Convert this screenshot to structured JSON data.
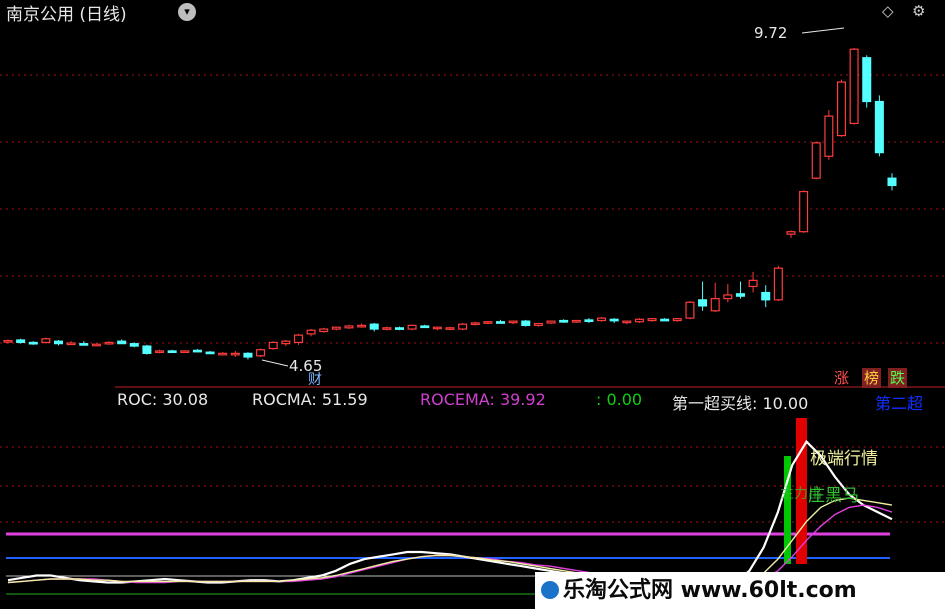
{
  "header": {
    "title": "南京公用 (日线)",
    "dropdown_glyph": "▾",
    "diamond_glyph": "◇",
    "gear_glyph": "⚙"
  },
  "indicator": {
    "roc_label": "ROC: 30.08",
    "rocma_label": "ROCMA: 51.59",
    "rocema_label": "ROCEMA: 39.92",
    "zero_label": ": 0.00",
    "buyline_label": "第一超买线: 10.00",
    "second_label": "第二超"
  },
  "badges": {
    "zhang": "涨",
    "bang": "榜",
    "die": "跌"
  },
  "watermark": "乐淘公式网 www.60lt.com",
  "colors": {
    "up": "#ff3c3c",
    "down": "#54ffff",
    "text": "#e8e8e8",
    "magenta": "#e040e0",
    "green": "#00d000",
    "blue": "#2060ff",
    "yellow": "#f0f0a0",
    "grid": "#a01010"
  },
  "chart_data": [
    {
      "type": "candlestick",
      "series_note": "",
      "max_label": "9.72",
      "min_label": "4.65",
      "cai_label": "财",
      "ylim": [
        4.2,
        10.2
      ],
      "ohlc": [
        [
          4.92,
          4.95,
          4.88,
          4.93
        ],
        [
          4.94,
          4.96,
          4.88,
          4.9
        ],
        [
          4.9,
          4.92,
          4.86,
          4.88
        ],
        [
          4.9,
          4.98,
          4.88,
          4.96
        ],
        [
          4.92,
          4.94,
          4.85,
          4.88
        ],
        [
          4.88,
          4.92,
          4.86,
          4.89
        ],
        [
          4.88,
          4.92,
          4.85,
          4.86
        ],
        [
          4.86,
          4.88,
          4.85,
          4.87
        ],
        [
          4.88,
          4.92,
          4.86,
          4.9
        ],
        [
          4.92,
          4.95,
          4.88,
          4.88
        ],
        [
          4.88,
          4.9,
          4.82,
          4.84
        ],
        [
          4.84,
          4.86,
          4.7,
          4.72
        ],
        [
          4.74,
          4.78,
          4.72,
          4.76
        ],
        [
          4.76,
          4.78,
          4.74,
          4.75
        ],
        [
          4.75,
          4.77,
          4.73,
          4.76
        ],
        [
          4.77,
          4.79,
          4.74,
          4.75
        ],
        [
          4.74,
          4.76,
          4.71,
          4.72
        ],
        [
          4.72,
          4.74,
          4.7,
          4.72
        ],
        [
          4.72,
          4.76,
          4.66,
          4.72
        ],
        [
          4.72,
          4.74,
          4.62,
          4.66
        ],
        [
          4.68,
          4.8,
          4.66,
          4.78
        ],
        [
          4.8,
          4.92,
          4.78,
          4.9
        ],
        [
          4.88,
          4.94,
          4.84,
          4.92
        ],
        [
          4.9,
          5.04,
          4.86,
          5.02
        ],
        [
          5.04,
          5.12,
          5.0,
          5.1
        ],
        [
          5.08,
          5.14,
          5.06,
          5.12
        ],
        [
          5.12,
          5.16,
          5.1,
          5.15
        ],
        [
          5.14,
          5.19,
          5.12,
          5.17
        ],
        [
          5.18,
          5.21,
          5.14,
          5.18
        ],
        [
          5.2,
          5.22,
          5.08,
          5.12
        ],
        [
          5.12,
          5.16,
          5.1,
          5.14
        ],
        [
          5.14,
          5.16,
          5.1,
          5.12
        ],
        [
          5.12,
          5.19,
          5.1,
          5.18
        ],
        [
          5.17,
          5.19,
          5.14,
          5.16
        ],
        [
          5.14,
          5.16,
          5.1,
          5.15
        ],
        [
          5.12,
          5.16,
          5.1,
          5.14
        ],
        [
          5.12,
          5.22,
          5.1,
          5.2
        ],
        [
          5.2,
          5.24,
          5.18,
          5.22
        ],
        [
          5.22,
          5.25,
          5.2,
          5.24
        ],
        [
          5.24,
          5.27,
          5.22,
          5.23
        ],
        [
          5.24,
          5.26,
          5.2,
          5.25
        ],
        [
          5.25,
          5.27,
          5.16,
          5.18
        ],
        [
          5.18,
          5.22,
          5.16,
          5.21
        ],
        [
          5.22,
          5.26,
          5.2,
          5.25
        ],
        [
          5.26,
          5.28,
          5.22,
          5.24
        ],
        [
          5.24,
          5.27,
          5.22,
          5.26
        ],
        [
          5.27,
          5.3,
          5.22,
          5.25
        ],
        [
          5.26,
          5.32,
          5.24,
          5.3
        ],
        [
          5.28,
          5.3,
          5.22,
          5.26
        ],
        [
          5.24,
          5.26,
          5.2,
          5.25
        ],
        [
          5.24,
          5.3,
          5.22,
          5.28
        ],
        [
          5.26,
          5.3,
          5.24,
          5.29
        ],
        [
          5.28,
          5.3,
          5.26,
          5.27
        ],
        [
          5.26,
          5.3,
          5.24,
          5.29
        ],
        [
          5.3,
          5.58,
          5.28,
          5.56
        ],
        [
          5.6,
          5.9,
          5.42,
          5.5
        ],
        [
          5.42,
          5.88,
          5.4,
          5.62
        ],
        [
          5.62,
          5.86,
          5.56,
          5.68
        ],
        [
          5.7,
          5.9,
          5.62,
          5.66
        ],
        [
          5.82,
          6.06,
          5.72,
          5.92
        ],
        [
          5.72,
          5.84,
          5.48,
          5.6
        ],
        [
          5.6,
          6.16,
          5.58,
          6.12
        ],
        [
          6.68,
          6.74,
          6.62,
          6.72
        ],
        [
          6.72,
          7.4,
          6.7,
          7.38
        ],
        [
          7.6,
          8.2,
          7.58,
          8.18
        ],
        [
          7.96,
          8.72,
          7.9,
          8.62
        ],
        [
          8.3,
          9.22,
          8.28,
          9.18
        ],
        [
          8.5,
          9.74,
          8.48,
          9.72
        ],
        [
          9.58,
          9.62,
          8.76,
          8.86
        ],
        [
          8.86,
          8.96,
          7.96,
          8.02
        ],
        [
          7.6,
          7.68,
          7.4,
          7.48
        ]
      ]
    },
    {
      "type": "line",
      "series": [
        {
          "name": "ROC",
          "values": [
            12,
            14,
            16,
            16,
            14,
            12,
            11,
            10,
            10,
            11,
            12,
            13,
            12,
            11,
            10,
            10,
            11,
            12,
            12,
            11,
            12,
            14,
            16,
            20,
            26,
            30,
            32,
            34,
            36,
            36,
            35,
            34,
            32,
            30,
            28,
            26,
            24,
            22,
            20,
            18,
            16,
            14,
            12,
            10,
            8,
            6,
            5,
            4,
            4,
            5,
            6,
            10,
            20,
            40,
            70,
            110,
            130,
            118,
            100,
            85,
            76,
            70,
            64
          ]
        },
        {
          "name": "ROCMA",
          "values": [
            10,
            11,
            12,
            13,
            13,
            13,
            13,
            12,
            11,
            10,
            10,
            10,
            11,
            11,
            11,
            11,
            11,
            11,
            11,
            11,
            11,
            12,
            13,
            15,
            18,
            21,
            24,
            27,
            30,
            32,
            33,
            33,
            32,
            31,
            30,
            28,
            27,
            25,
            24,
            22,
            20,
            18,
            16,
            14,
            12,
            10,
            9,
            8,
            7,
            6,
            6,
            7,
            9,
            13,
            20,
            32,
            46,
            58,
            68,
            74,
            76,
            74,
            70
          ]
        },
        {
          "name": "ROCEMA",
          "values": [
            10,
            11,
            12,
            13,
            13,
            13,
            12,
            12,
            11,
            11,
            11,
            11,
            11,
            11,
            11,
            11,
            11,
            11,
            11,
            11,
            12,
            13,
            14,
            16,
            19,
            22,
            25,
            28,
            30,
            32,
            33,
            33,
            32,
            31,
            29,
            28,
            26,
            24,
            22,
            20,
            18,
            16,
            14,
            12,
            11,
            9,
            8,
            7,
            6,
            6,
            6,
            8,
            11,
            18,
            30,
            46,
            62,
            74,
            80,
            82,
            80,
            78,
            76
          ]
        }
      ],
      "ylim": [
        -10,
        140
      ],
      "buy_line": 10.0,
      "zero_line": 0.0,
      "annot_extreme": "极端行情",
      "annot_main": "主力出",
      "annot_black": "庄黑马"
    }
  ]
}
